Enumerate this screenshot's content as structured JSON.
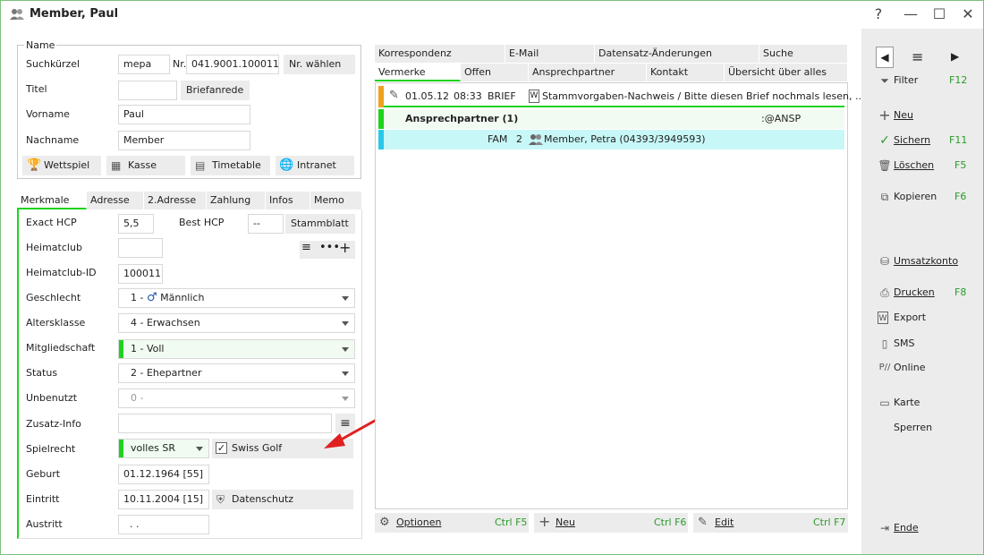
{
  "window": {
    "title": "Member, Paul"
  },
  "name_group": {
    "legend": "Name",
    "suchkuerzel_label": "Suchkürzel",
    "suchkuerzel_value": "mepa",
    "nr_label": "Nr.",
    "nr_value": "041.9001.100011",
    "nr_button": "Nr. wählen",
    "titel_label": "Titel",
    "titel_value": "",
    "briefanrede_button": "Briefanrede",
    "vorname_label": "Vorname",
    "vorname_value": "Paul",
    "nachname_label": "Nachname",
    "nachname_value": "Member",
    "buttons": [
      "Wettspiel",
      "Kasse",
      "Timetable",
      "Intranet"
    ]
  },
  "left_tabs": [
    "Merkmale",
    "Adresse",
    "2.Adresse",
    "Zahlung",
    "Infos",
    "Memo"
  ],
  "merkmale": {
    "exact_hcp_label": "Exact HCP",
    "exact_hcp_value": "5,5",
    "best_hcp_label": "Best HCP",
    "best_hcp_value": "--",
    "stammblatt_button": "Stammblatt",
    "heimatclub_label": "Heimatclub",
    "heimatclub_value": "",
    "heimatclub_id_label": "Heimatclub-ID",
    "heimatclub_id_value": "100011",
    "geschlecht_label": "Geschlecht",
    "geschlecht_value": "1 -",
    "geschlecht_text": "Männlich",
    "altersklasse_label": "Altersklasse",
    "altersklasse_value": "4 - Erwachsen",
    "mitgliedschaft_label": "Mitgliedschaft",
    "mitgliedschaft_value": "1 - Voll",
    "status_label": "Status",
    "status_value": "2 - Ehepartner",
    "unbenutzt_label": "Unbenutzt",
    "unbenutzt_value": "0 -",
    "zusatz_label": "Zusatz-Info",
    "zusatz_value": "",
    "spielrecht_label": "Spielrecht",
    "spielrecht_value": "volles SR",
    "swiss_golf_label": "Swiss Golf",
    "geburt_label": "Geburt",
    "geburt_value": "01.12.1964  [55]",
    "eintritt_label": "Eintritt",
    "eintritt_value": "10.11.2004  [15]",
    "datenschutz_button": "Datenschutz",
    "austritt_label": "Austritt",
    "austritt_value": ". ."
  },
  "right_tabs_row1": [
    "Korrespondenz",
    "E-Mail",
    "Datensatz-Änderungen",
    "Suche"
  ],
  "right_tabs_row2": [
    "Vermerke",
    "Offen",
    "Ansprechpartner",
    "Kontakt",
    "Übersicht über alles"
  ],
  "list": {
    "row1": {
      "date": "01.05.12",
      "time": "08:33",
      "type": "BRIEF",
      "text": "Stammvorgaben-Nachweis / Bitte diesen Brief nochmals lesen, ..."
    },
    "row2": {
      "text": "Ansprechpartner (1)",
      "code": ":@ANSP"
    },
    "row3": {
      "code": "FAM",
      "num": "2",
      "text": "Member, Petra (04393/3949593)"
    }
  },
  "bottom_buttons": [
    {
      "label": "Optionen",
      "key": "Ctrl F5"
    },
    {
      "label": "Neu",
      "key": "Ctrl F6"
    },
    {
      "label": "Edit",
      "key": "Ctrl F7"
    }
  ],
  "right_panel": {
    "filter": {
      "label": "Filter",
      "key": "F12"
    },
    "neu": {
      "label": "Neu"
    },
    "sichern": {
      "label": "Sichern",
      "key": "F11"
    },
    "loeschen": {
      "label": "Löschen",
      "key": "F5"
    },
    "kopieren": {
      "label": "Kopieren",
      "key": "F6"
    },
    "umsatzkonto": {
      "label": "Umsatzkonto"
    },
    "drucken": {
      "label": "Drucken",
      "key": "F8"
    },
    "export": {
      "label": "Export"
    },
    "sms": {
      "label": "SMS"
    },
    "online": {
      "label": "Online"
    },
    "karte": {
      "label": "Karte"
    },
    "sperren": {
      "label": "Sperren"
    },
    "ende": {
      "label": "Ende"
    }
  },
  "colors": {
    "accent_green": "#1ed31e",
    "key_green": "#2a9a2a",
    "selected_row": "#c8f7f7",
    "arrow": "#e02020"
  }
}
